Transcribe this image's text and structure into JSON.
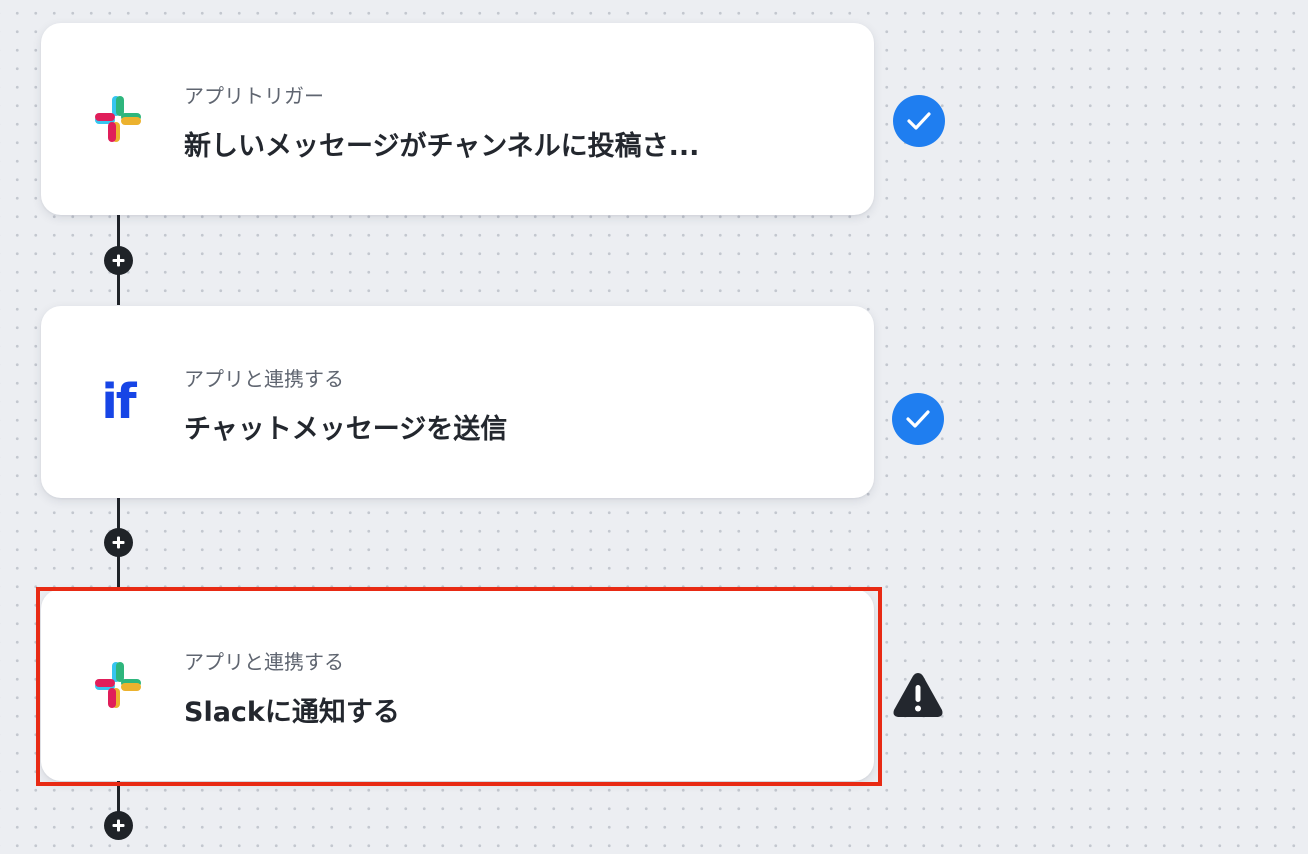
{
  "flow": {
    "steps": [
      {
        "subtitle": "アプリトリガー",
        "title": "新しいメッセージがチャンネルに投稿さ...",
        "icon": "slack-icon",
        "status": "success"
      },
      {
        "subtitle": "アプリと連携する",
        "title": "チャットメッセージを送信",
        "icon": "if-icon",
        "icon_text": "if",
        "status": "success"
      },
      {
        "subtitle": "アプリと連携する",
        "title": "Slackに通知する",
        "icon": "slack-icon",
        "status": "warning",
        "highlighted": true
      }
    ]
  },
  "colors": {
    "accent": "#1f7ef0",
    "highlight_border": "#e82a14",
    "connector": "#1f2328",
    "if_brand": "#1745e6"
  }
}
